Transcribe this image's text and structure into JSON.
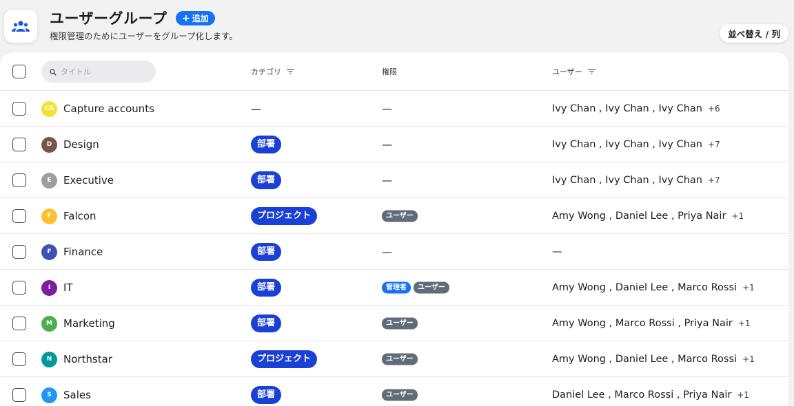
{
  "header": {
    "title": "ユーザーグループ",
    "add_label": "追加",
    "subtitle": "権限管理のためにユーザーをグループ化します。",
    "sort_label": "並べ替え / 列"
  },
  "table": {
    "search_placeholder": "タイトル",
    "columns": {
      "category": "カテゴリ",
      "permission": "権限",
      "users": "ユーザー"
    },
    "rows": [
      {
        "initials": "CA",
        "name": "Capture accounts",
        "avatar_color": "#f5e134",
        "category": "—",
        "permissions": [],
        "permission_empty": "—",
        "users": "Ivy Chan , Ivy Chan , Ivy Chan",
        "more": "+6"
      },
      {
        "initials": "D",
        "name": "Design",
        "avatar_color": "#795548",
        "category": "部署",
        "permissions": [],
        "permission_empty": "—",
        "users": "Ivy Chan , Ivy Chan , Ivy Chan",
        "more": "+7"
      },
      {
        "initials": "E",
        "name": "Executive",
        "avatar_color": "#9e9e9e",
        "category": "部署",
        "permissions": [],
        "permission_empty": "—",
        "users": "Ivy Chan , Ivy Chan , Ivy Chan",
        "more": "+7"
      },
      {
        "initials": "F",
        "name": "Falcon",
        "avatar_color": "#fbc02d",
        "category": "プロジェクト",
        "permissions": [
          "ユーザー"
        ],
        "permission_empty": "—",
        "users": "Amy Wong , Daniel Lee , Priya Nair",
        "more": "+1"
      },
      {
        "initials": "F",
        "name": "Finance",
        "avatar_color": "#3f51b5",
        "category": "部署",
        "permissions": [],
        "permission_empty": "—",
        "users": "—",
        "more": ""
      },
      {
        "initials": "I",
        "name": "IT",
        "avatar_color": "#7b1fa2",
        "category": "部署",
        "permissions": [
          "管理者",
          "ユーザー"
        ],
        "permission_empty": "—",
        "users": "Amy Wong , Daniel Lee , Marco Rossi",
        "more": "+1"
      },
      {
        "initials": "M",
        "name": "Marketing",
        "avatar_color": "#4caf50",
        "category": "部署",
        "permissions": [
          "ユーザー"
        ],
        "permission_empty": "—",
        "users": "Amy Wong , Marco Rossi , Priya Nair",
        "more": "+1"
      },
      {
        "initials": "N",
        "name": "Northstar",
        "avatar_color": "#00979d",
        "category": "プロジェクト",
        "permissions": [
          "ユーザー"
        ],
        "permission_empty": "—",
        "users": "Amy Wong , Daniel Lee , Marco Rossi",
        "more": "+1"
      },
      {
        "initials": "S",
        "name": "Sales",
        "avatar_color": "#2196f3",
        "category": "部署",
        "permissions": [
          "ユーザー"
        ],
        "permission_empty": "—",
        "users": "Daniel Lee , Marco Rossi , Priya Nair",
        "more": "+1"
      }
    ]
  },
  "colors": {
    "accent": "#1672f3",
    "category_badge": "#1a40d6",
    "user_badge": "#626b78"
  },
  "icons": {
    "app": "user-group-icon",
    "search": "search-icon",
    "filter": "filter-icon",
    "add": "plus-icon"
  }
}
